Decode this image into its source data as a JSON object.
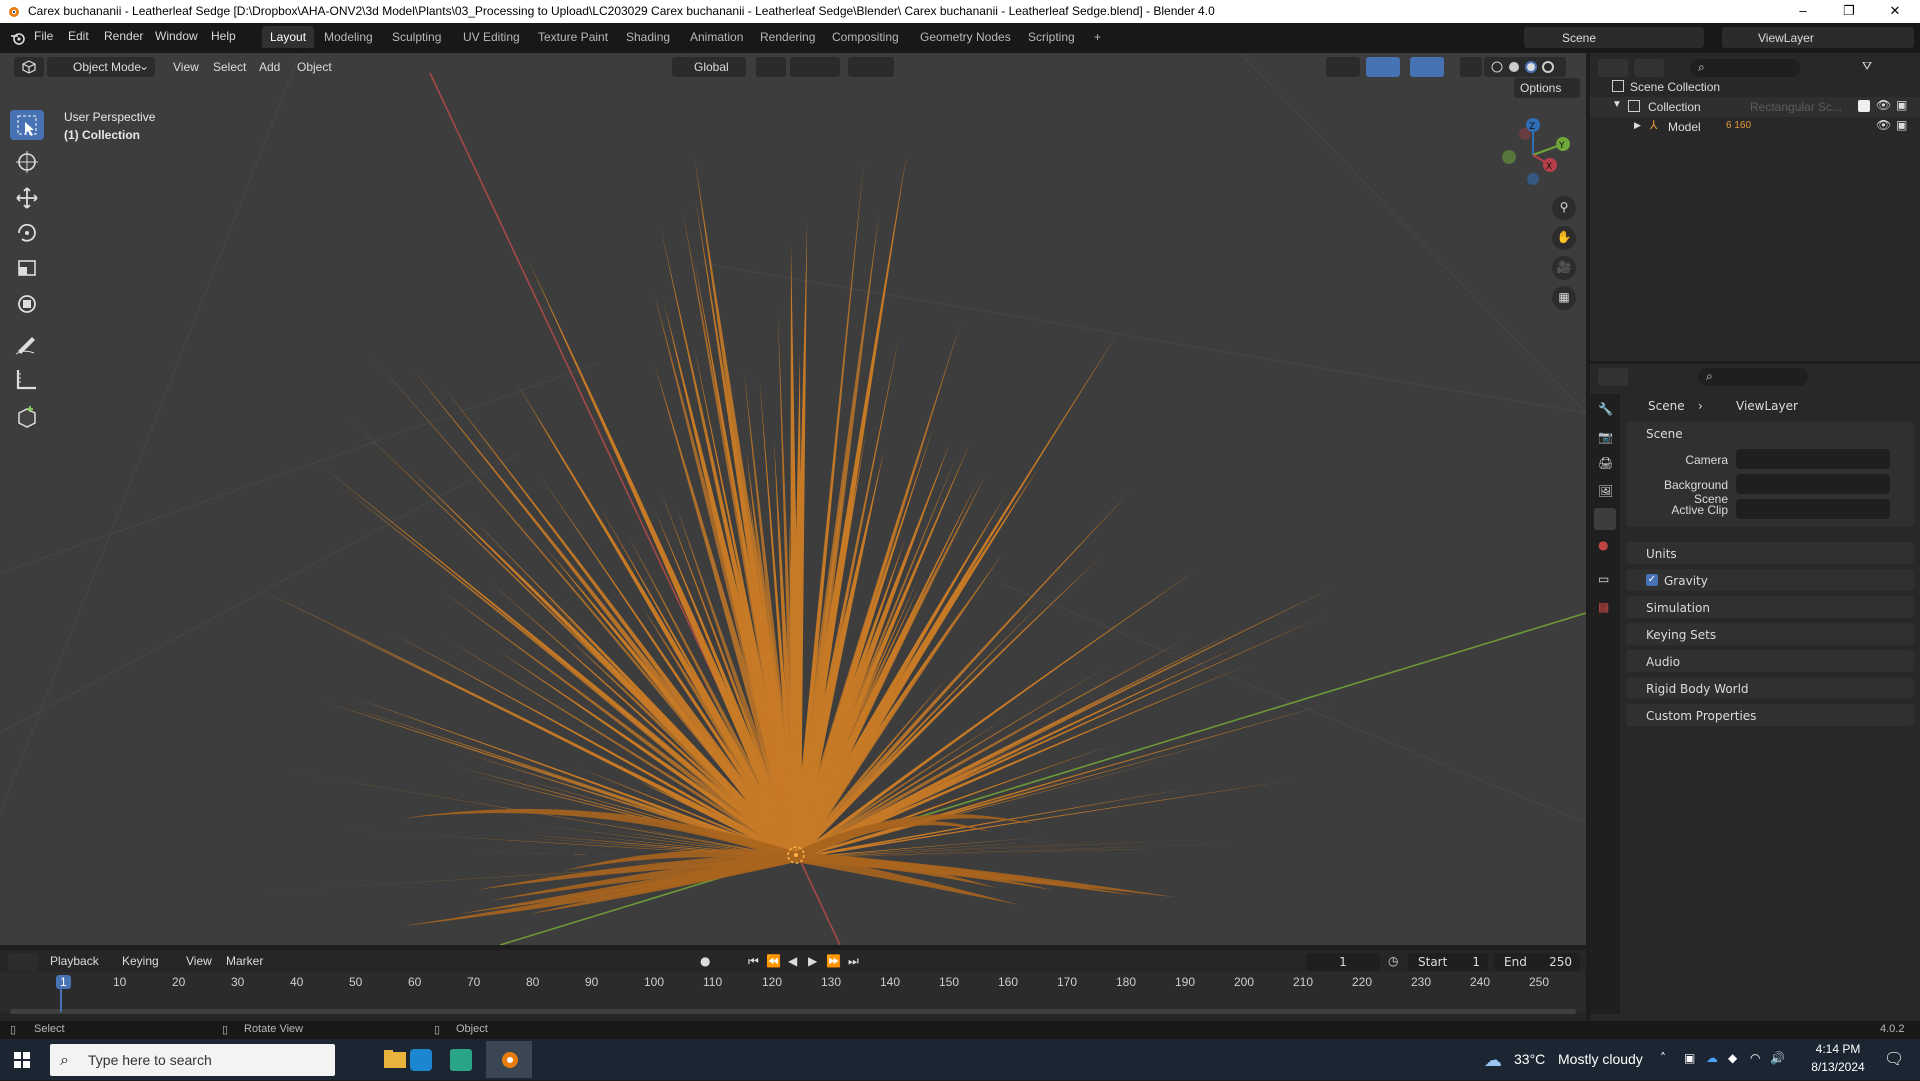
{
  "window": {
    "title": "Carex buchananii - Leatherleaf Sedge [D:\\Dropbox\\AHA-ONV2\\3d Model\\Plants\\03_Processing to Upload\\LC203029 Carex buchananii - Leatherleaf Sedge\\Blender\\ Carex buchananii - Leatherleaf Sedge.blend] - Blender 4.0",
    "minimize": "–",
    "maximize": "❐",
    "close": "✕"
  },
  "menu": [
    "File",
    "Edit",
    "Render",
    "Window",
    "Help"
  ],
  "workspaces": [
    "Layout",
    "Modeling",
    "Sculpting",
    "UV Editing",
    "Texture Paint",
    "Shading",
    "Animation",
    "Rendering",
    "Compositing",
    "Geometry Nodes",
    "Scripting"
  ],
  "workspace_add": "+",
  "scene_selector": "Scene",
  "viewlayer_selector": "ViewLayer",
  "viewport": {
    "mode": "Object Mode",
    "menus": [
      "View",
      "Select",
      "Add",
      "Object"
    ],
    "transform_orientation": "Global",
    "options": "Options",
    "overlay_line1": "User Perspective",
    "overlay_line2": "(1) Collection",
    "gizmo_labels": {
      "z": "Z",
      "y": "Y",
      "x": "X"
    }
  },
  "outliner": {
    "root": "Scene Collection",
    "collection": "Collection",
    "model": "Model",
    "model_badge": "6 160",
    "ghost_item": "Rectangular Sc..."
  },
  "properties": {
    "breadcrumb_scene": "Scene",
    "breadcrumb_viewlayer": "ViewLayer",
    "panel_scene": "Scene",
    "camera_label": "Camera",
    "bg_scene_label": "Background Scene",
    "active_clip_label": "Active Clip",
    "panels": [
      "Units",
      "Gravity",
      "Simulation",
      "Keying Sets",
      "Audio",
      "Rigid Body World",
      "Custom Properties"
    ],
    "gravity_checked": true
  },
  "timeline": {
    "menus": [
      "Playback",
      "Keying",
      "View",
      "Marker"
    ],
    "current_frame": "1",
    "start_label": "Start",
    "start_value": "1",
    "end_label": "End",
    "end_value": "250",
    "ticks": [
      "1",
      "10",
      "20",
      "30",
      "40",
      "50",
      "60",
      "70",
      "80",
      "90",
      "100",
      "110",
      "120",
      "130",
      "140",
      "150",
      "160",
      "170",
      "180",
      "190",
      "200",
      "210",
      "220",
      "230",
      "240",
      "250"
    ]
  },
  "statusbar": {
    "select": "Select",
    "rotate_view": "Rotate View",
    "object": "Object",
    "version": "4.0.2"
  },
  "taskbar": {
    "search_placeholder": "Type here to search",
    "weather_temp": "33°C",
    "weather_desc": "Mostly cloudy",
    "time": "4:14 PM",
    "date": "8/13/2024"
  },
  "colors": {
    "accent": "#4772b3",
    "viewport_bg": "#3d3d3d",
    "grass": "#c77a26",
    "axis_x": "#b34b4b",
    "axis_y": "#6b9a3a"
  }
}
